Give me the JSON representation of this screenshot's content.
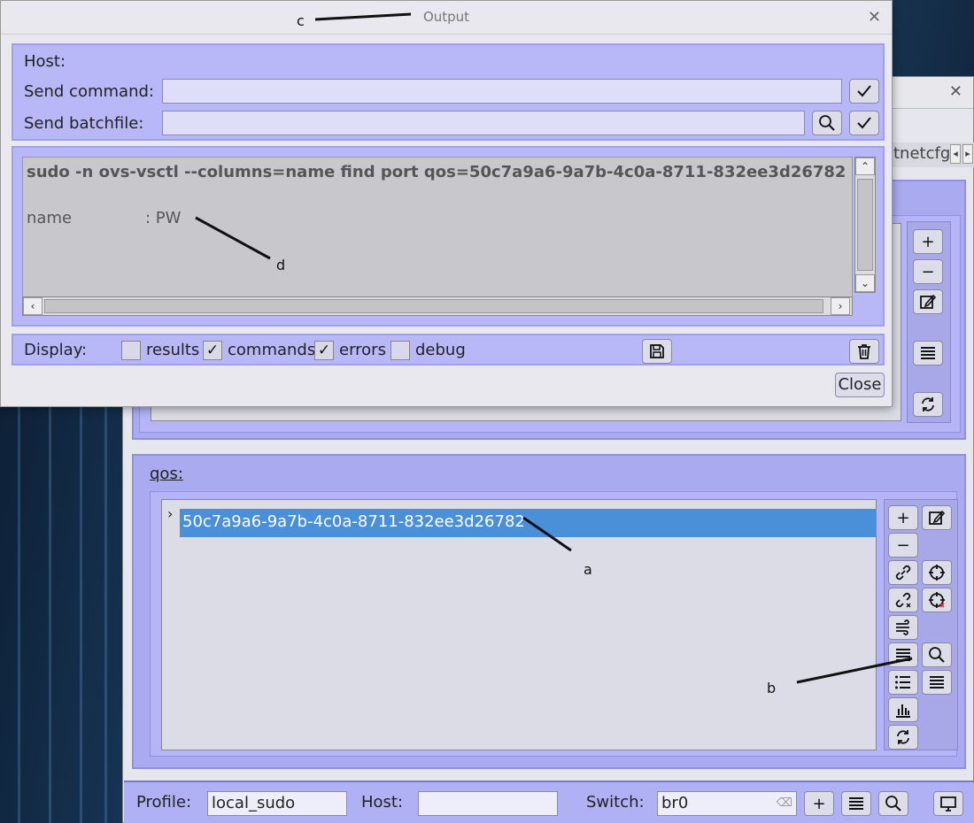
{
  "dialog": {
    "title": "Output",
    "host_label": "Host:",
    "send_command_label": "Send command:",
    "send_command_value": "",
    "send_batchfile_label": "Send batchfile:",
    "send_batchfile_value": "",
    "output_command": "sudo -n ovs-vsctl --columns=name find port qos=50c7a9a6-9a7b-4c0a-8711-832ee3d26782",
    "output_result_key": "name",
    "output_result_value": ": PW",
    "display_label": "Display:",
    "checkboxes": [
      {
        "label": "results",
        "checked": false
      },
      {
        "label": "commands",
        "checked": true
      },
      {
        "label": "errors",
        "checked": true
      },
      {
        "label": "debug",
        "checked": false
      }
    ],
    "close_label": "Close"
  },
  "main": {
    "tab_partial": "tnetcfg",
    "qos_label": "qos:",
    "qos_items": [
      {
        "id": "50c7a9a6-9a7b-4c0a-8711-832ee3d26782",
        "selected": true
      }
    ]
  },
  "bottombar": {
    "profile_label": "Profile:",
    "profile_value": "local_sudo",
    "host_label": "Host:",
    "host_value": "",
    "switch_label": "Switch:",
    "switch_value": "br0"
  },
  "annotations": {
    "a": "a",
    "b": "b",
    "c": "c",
    "d": "d"
  },
  "colors": {
    "selection": "#4a90d9",
    "panel": "#b8b8f8",
    "frame": "#aaaaf0"
  }
}
